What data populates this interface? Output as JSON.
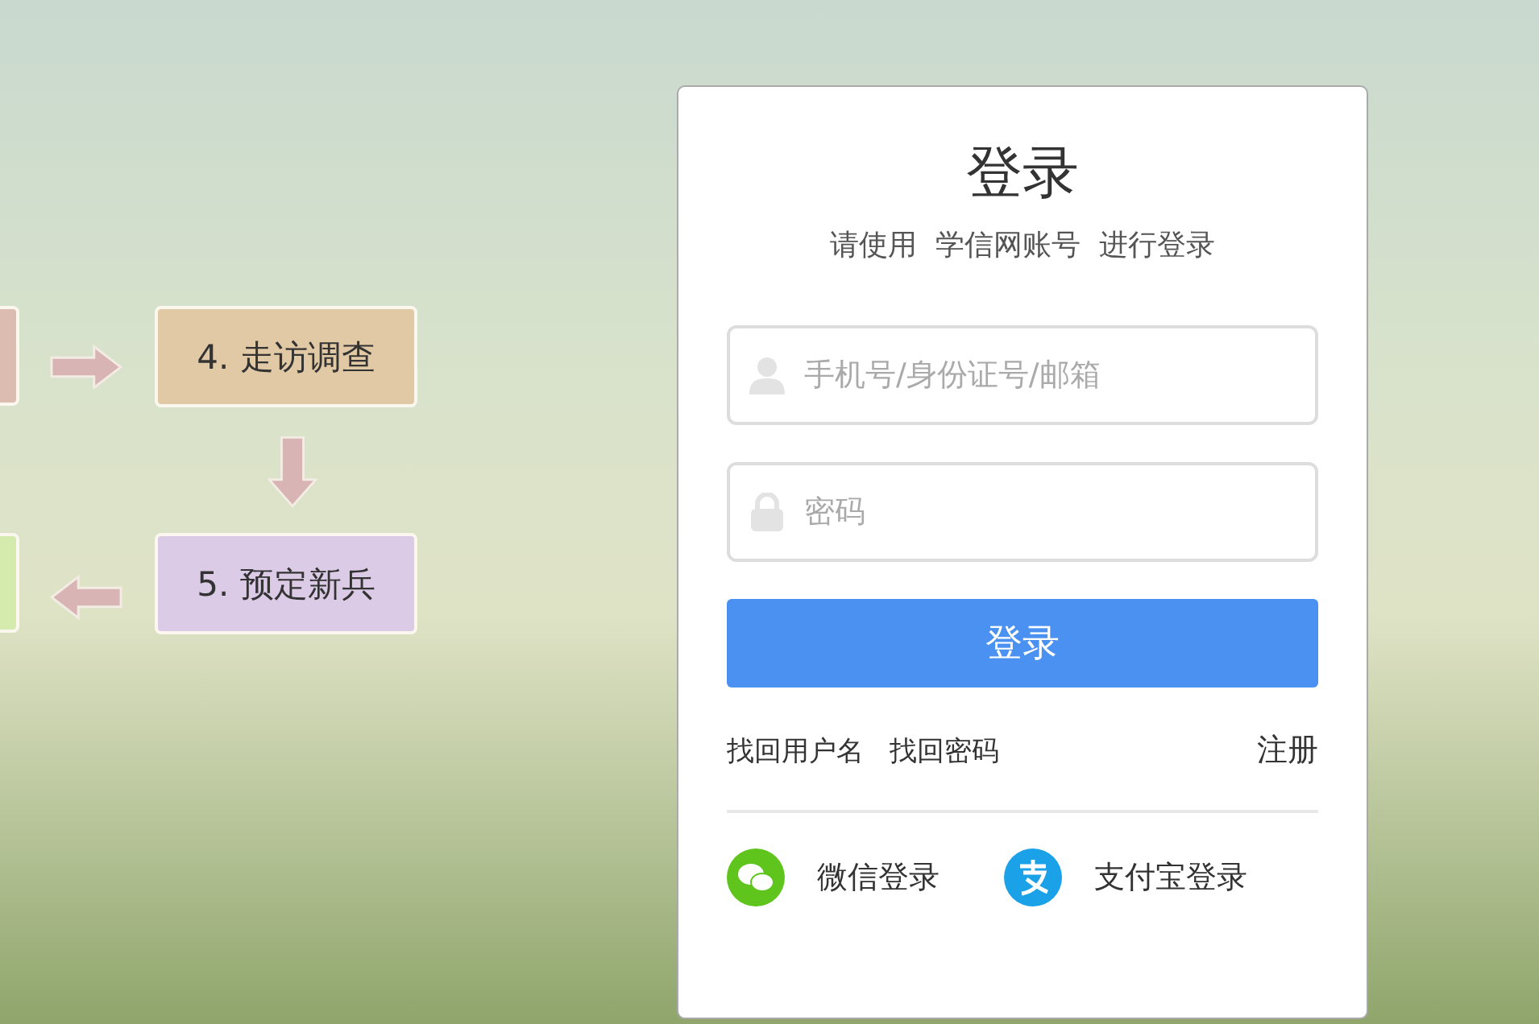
{
  "flow_steps": [
    {
      "label": "4. 走访调查",
      "color": "#e2c9a6"
    },
    {
      "label": "5. 预定新兵",
      "color": "#dccbe6"
    }
  ],
  "login": {
    "title": "登录",
    "subtitle": "请使用  学信网账号  进行登录",
    "username": {
      "placeholder": "手机号/身份证号/邮箱"
    },
    "password": {
      "placeholder": "密码"
    },
    "submit": "登录",
    "links": [
      "找回用户名",
      "找回密码"
    ],
    "register": "注册",
    "social": [
      {
        "kind": "wechat",
        "label": "微信登录"
      },
      {
        "kind": "alipay",
        "label": "支付宝登录"
      }
    ]
  }
}
